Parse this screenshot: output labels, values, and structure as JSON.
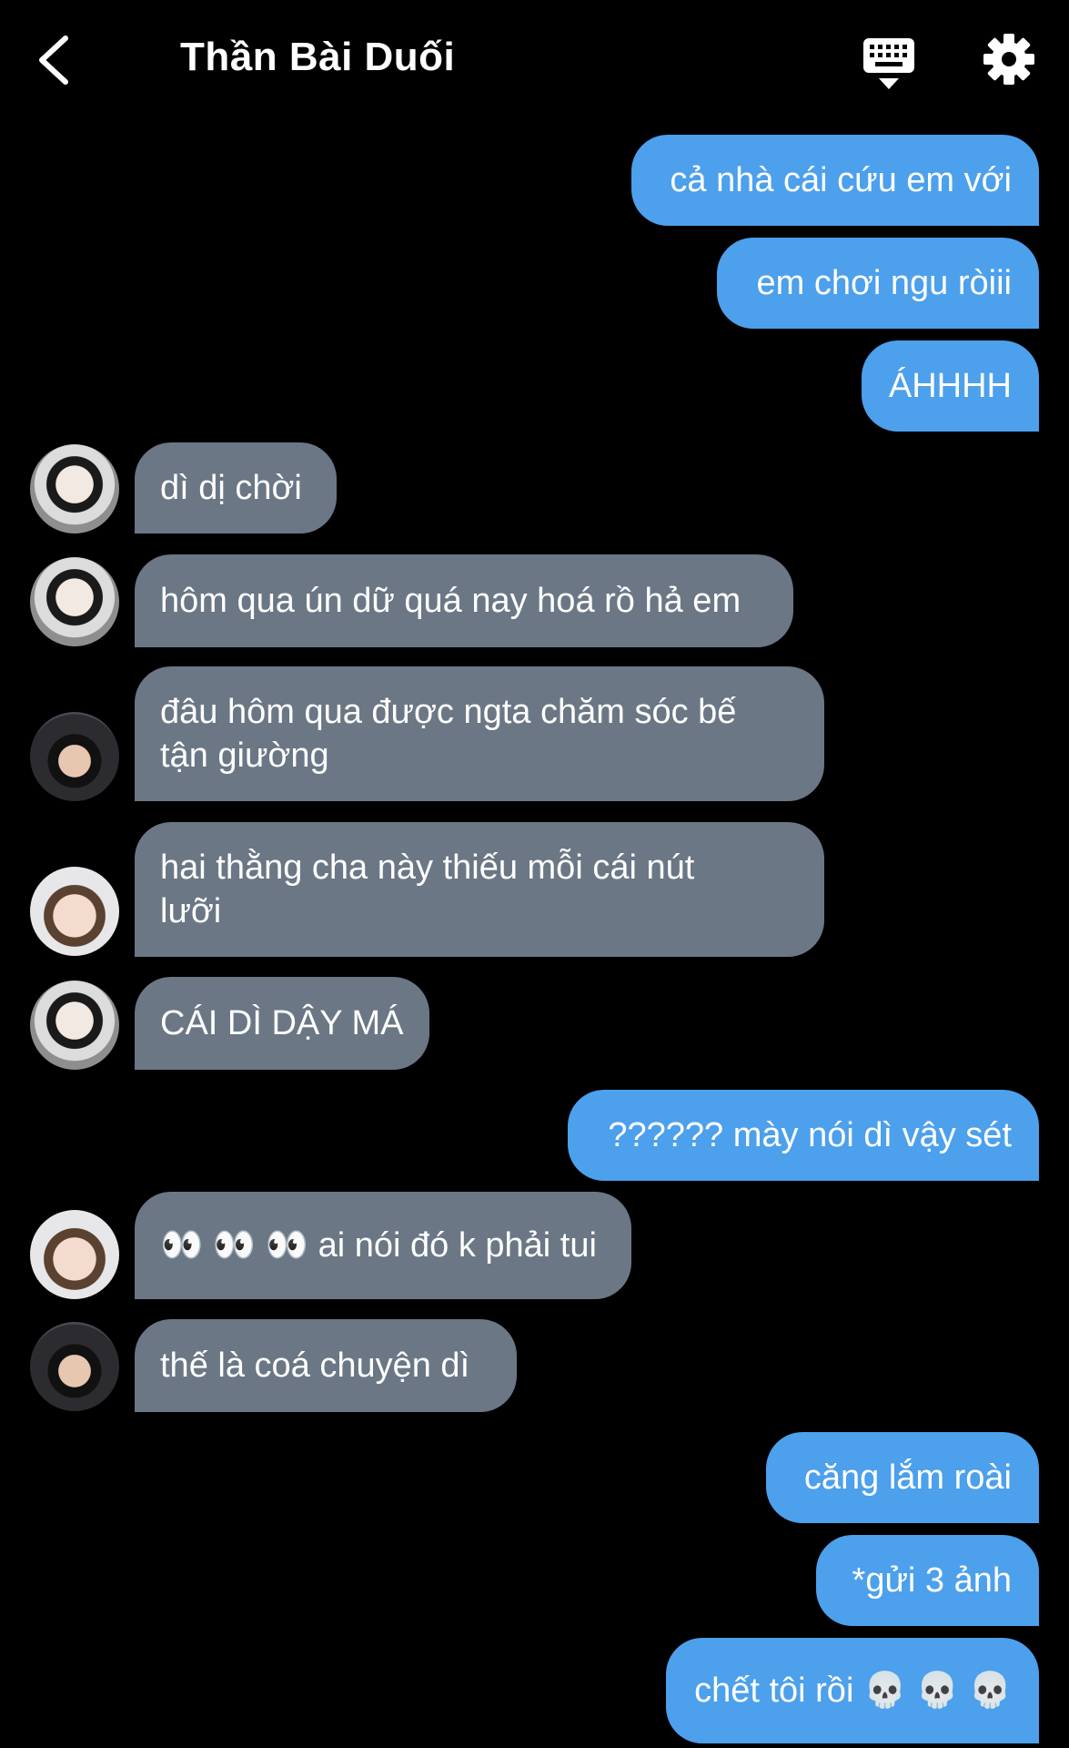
{
  "header": {
    "title": "Thần Bài Duối",
    "back_icon": "chevron-left-icon",
    "keyboard_icon": "keyboard-icon",
    "settings_icon": "gear-icon"
  },
  "colors": {
    "background": "#000000",
    "outgoing_bubble": "#4ca0ec",
    "incoming_bubble": "#6b7785",
    "text": "#ffffff"
  },
  "messages": [
    {
      "dir": "out",
      "text": "cả nhà cái cứu em với"
    },
    {
      "dir": "out",
      "text": "em chơi ngu ròiii"
    },
    {
      "dir": "out",
      "text": "ÁHHHH"
    },
    {
      "dir": "in",
      "avatar": "avatar-a",
      "text": "dì dị chời"
    },
    {
      "dir": "in",
      "avatar": "avatar-a",
      "text": "hôm qua ún dữ quá nay hoá rồ hả em"
    },
    {
      "dir": "in",
      "avatar": "avatar-b",
      "text": "đâu hôm qua được ngta chăm sóc bế tận giường"
    },
    {
      "dir": "in",
      "avatar": "avatar-c",
      "text": "hai thằng cha này thiếu mỗi cái nút lưỡi"
    },
    {
      "dir": "in",
      "avatar": "avatar-a",
      "text": "CÁI DÌ DẬY MÁ"
    },
    {
      "dir": "out",
      "text": "?????? mày nói dì vậy sét"
    },
    {
      "dir": "in",
      "avatar": "avatar-c",
      "text": "👀 👀 👀  ai nói đó k phải tui"
    },
    {
      "dir": "in",
      "avatar": "avatar-b",
      "text": "thế là coá chuyện dì"
    },
    {
      "dir": "out",
      "text": "căng lắm roài"
    },
    {
      "dir": "out",
      "text": "*gửi 3 ảnh"
    },
    {
      "dir": "out",
      "text": "chết tôi rồi 💀 💀 💀"
    }
  ]
}
